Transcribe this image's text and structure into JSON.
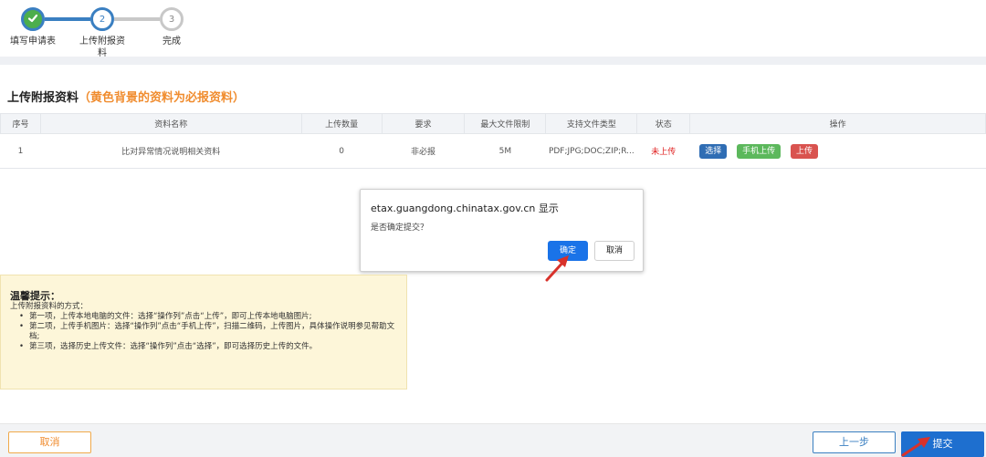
{
  "stepper": {
    "steps": [
      {
        "number": "",
        "label": "填写申请表",
        "state": "done",
        "icon": "check-icon"
      },
      {
        "number": "2",
        "label": "上传附报资料",
        "state": "current"
      },
      {
        "number": "3",
        "label": "完成",
        "state": "pending"
      }
    ]
  },
  "section": {
    "title": "上传附报资料",
    "note": "（黄色背景的资料为必报资料）"
  },
  "table": {
    "headers": [
      "序号",
      "资料名称",
      "上传数量",
      "要求",
      "最大文件限制",
      "支持文件类型",
      "状态",
      "操作"
    ],
    "rows": [
      {
        "index": "1",
        "name": "比对异常情况说明相关资料",
        "count": "0",
        "requirement": "非必报",
        "max_size": "5M",
        "file_types": "PDF;JPG;DOC;ZIP;R...",
        "status": "未上传",
        "actions": {
          "select": "选择",
          "mobile": "手机上传",
          "upload": "上传"
        }
      }
    ]
  },
  "dialog": {
    "title": "etax.guangdong.chinatax.gov.cn 显示",
    "message": "是否确定提交？",
    "ok": "确定",
    "cancel": "取消"
  },
  "tips": {
    "title": "温馨提示：",
    "intro": "上传附报资料的方式：",
    "items": [
      "第一项，上传本地电脑的文件：选择“操作列”点击“上传”，即可上传本地电脑图片;",
      "第二项，上传手机图片：选择“操作列”点击“手机上传”，扫描二维码，上传图片，具体操作说明参见帮助文档;",
      "第三项，选择历史上传文件：选择“操作列”点击“选择”，即可选择历史上传的文件。"
    ]
  },
  "footer": {
    "cancel": "取消",
    "prev": "上一步",
    "submit": "提交"
  },
  "colors": {
    "primary_blue": "#1a73e8",
    "step_blue": "#3a7fc1",
    "accent_orange": "#f08c2e",
    "tips_bg": "#fdf6d9",
    "error_red": "#e02020"
  }
}
